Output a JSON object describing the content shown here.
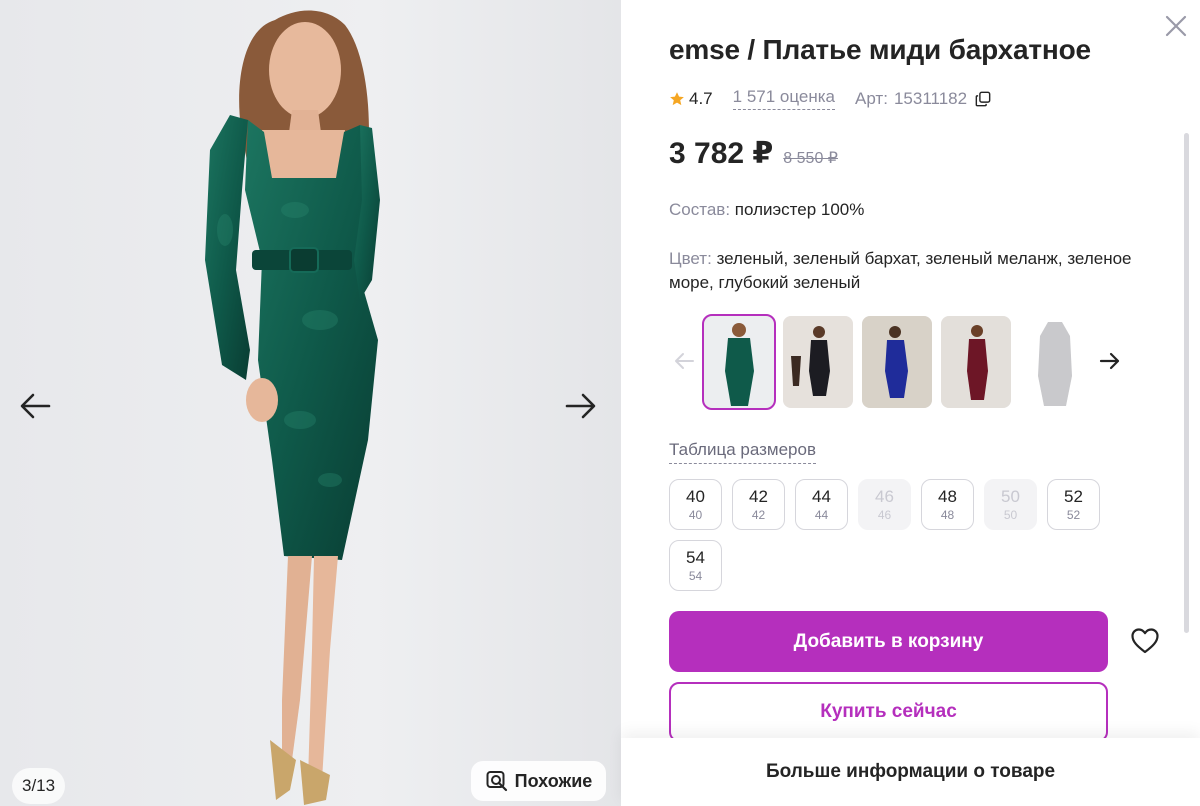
{
  "gallery": {
    "counter": "3/13",
    "similar_label": "Похожие",
    "dress_color": "#0f5a4a"
  },
  "product": {
    "title": "emse / Платье миди бархатное",
    "rating": "4.7",
    "reviews": "1 571 оценка",
    "art_label": "Арт:",
    "art_value": "15311182",
    "price_now": "3 782 ₽",
    "price_old": "8 550 ₽",
    "composition_label": "Состав:",
    "composition_value": "полиэстер 100%",
    "color_label": "Цвет:",
    "color_value": "зеленый, зеленый бархат, зеленый меланж, зеленое море, глубокий зеленый"
  },
  "thumbnails": [
    {
      "name": "green",
      "color": "#0f5a4a",
      "selected": true
    },
    {
      "name": "black",
      "color": "#1c1c22",
      "selected": false
    },
    {
      "name": "blue",
      "color": "#1f2c9a",
      "selected": false
    },
    {
      "name": "burgundy",
      "color": "#6d1626",
      "selected": false
    },
    {
      "name": "grey",
      "color": "#c9c9cc",
      "selected": false
    }
  ],
  "sizes": {
    "table_link": "Таблица размеров",
    "items": [
      {
        "main": "40",
        "sub": "40",
        "available": true
      },
      {
        "main": "42",
        "sub": "42",
        "available": true
      },
      {
        "main": "44",
        "sub": "44",
        "available": true
      },
      {
        "main": "46",
        "sub": "46",
        "available": false
      },
      {
        "main": "48",
        "sub": "48",
        "available": true
      },
      {
        "main": "50",
        "sub": "50",
        "available": false
      },
      {
        "main": "52",
        "sub": "52",
        "available": true
      },
      {
        "main": "54",
        "sub": "54",
        "available": true
      }
    ]
  },
  "actions": {
    "add_to_cart": "Добавить в корзину",
    "buy_now": "Купить сейчас",
    "more_info": "Больше информации о товаре"
  },
  "colors": {
    "accent": "#b52fbd",
    "text": "#242424",
    "muted": "#8a8a9b",
    "star": "#f5a623"
  }
}
